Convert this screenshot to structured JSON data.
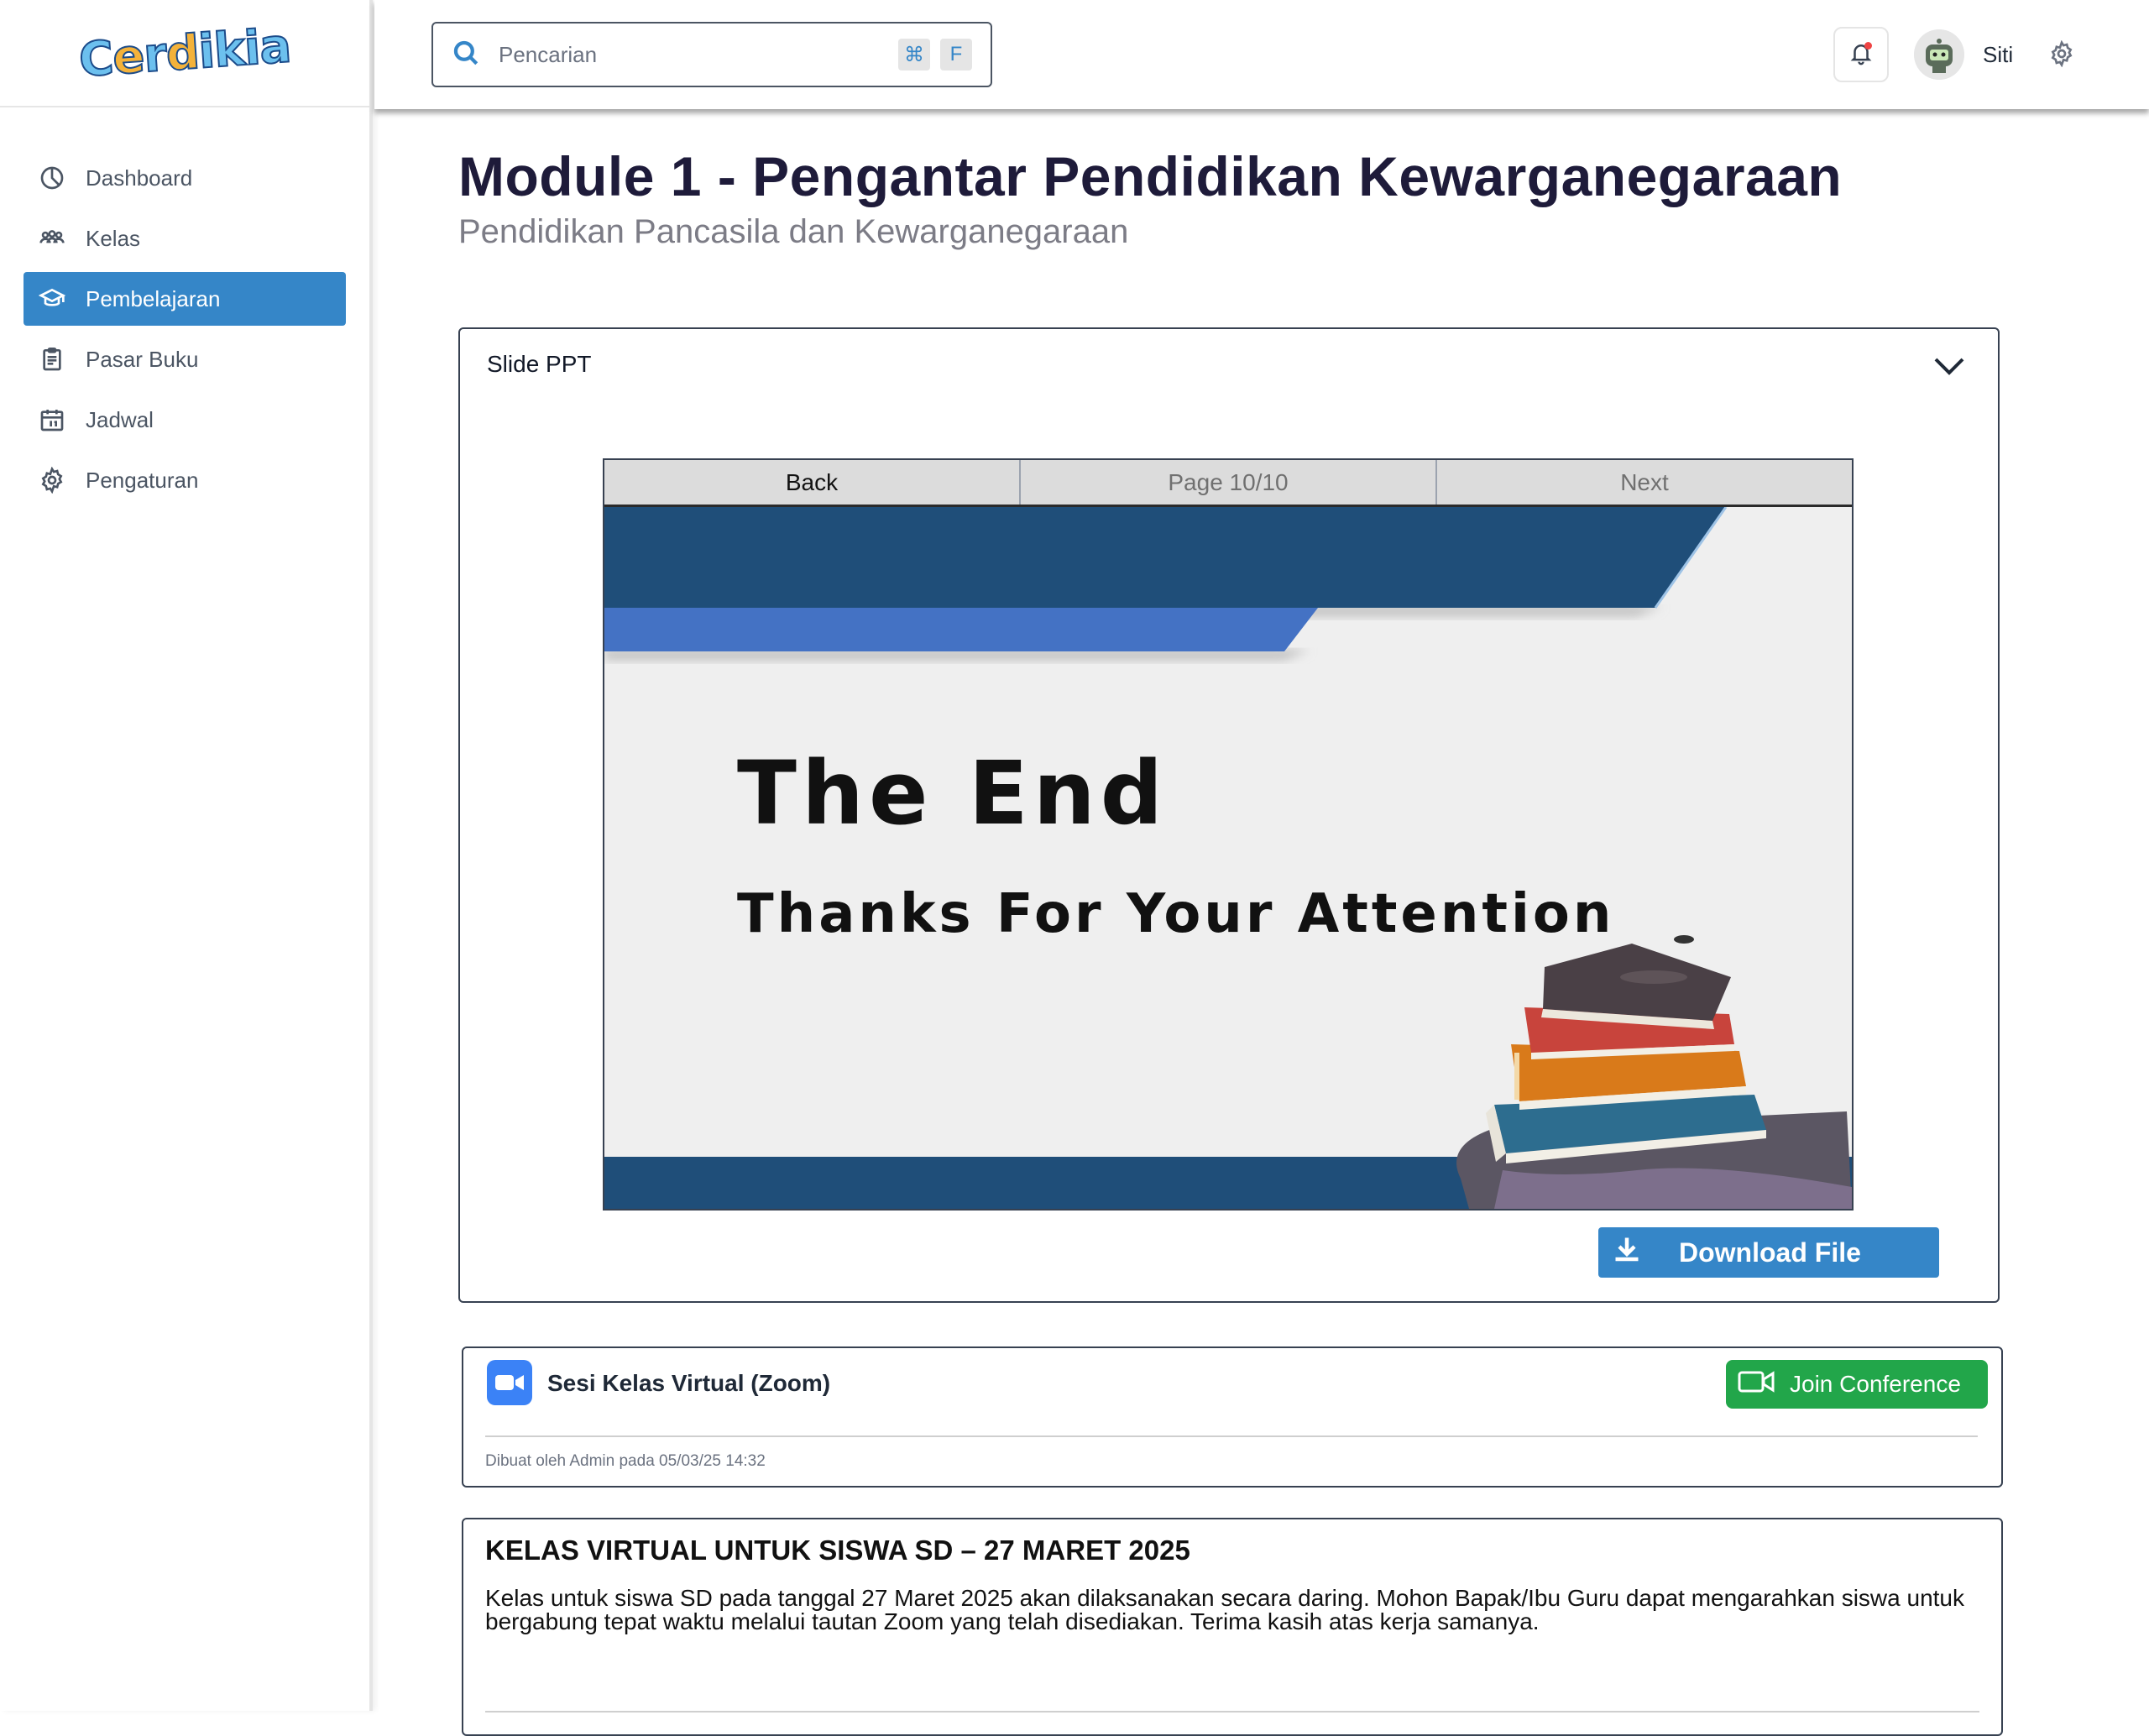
{
  "app": {
    "logo_text": "Cerdikia"
  },
  "sidebar": {
    "items": [
      {
        "label": "Dashboard",
        "icon": "pie-chart-icon"
      },
      {
        "label": "Kelas",
        "icon": "users-icon"
      },
      {
        "label": "Pembelajaran",
        "icon": "graduation-cap-icon",
        "active": true
      },
      {
        "label": "Pasar Buku",
        "icon": "clipboard-icon"
      },
      {
        "label": "Jadwal",
        "icon": "calendar-icon"
      },
      {
        "label": "Pengaturan",
        "icon": "gear-icon"
      }
    ]
  },
  "header": {
    "search": {
      "placeholder": "Pencarian",
      "shortcut_keys": [
        "⌘",
        "F"
      ]
    },
    "user": {
      "name": "Siti"
    }
  },
  "main": {
    "title": "Module 1 - Pengantar Pendidikan Kewarganegaraan",
    "subtitle": "Pendidikan Pancasila dan Kewarganegaraan",
    "slide_card": {
      "title": "Slide PPT",
      "viewer": {
        "back_label": "Back",
        "page_label": "Page 10/10",
        "next_label": "Next",
        "slide_title": "The End",
        "slide_subtitle": "Thanks For Your Attention"
      },
      "download_label": "Download File"
    },
    "zoom_card": {
      "title": "Sesi Kelas Virtual (Zoom)",
      "join_label": "Join Conference",
      "meta": "Dibuat oleh Admin pada 05/03/25 14:32"
    },
    "announcement": {
      "title": "KELAS VIRTUAL UNTUK SISWA SD – 27 MARET 2025",
      "body": "Kelas untuk siswa SD pada tanggal 27 Maret 2025 akan dilaksanakan secara daring. Mohon Bapak/Ibu Guru dapat mengarahkan siswa untuk bergabung tepat waktu melalui tautan Zoom yang telah disediakan. Terima kasih atas kerja samanya."
    }
  },
  "colors": {
    "accent": "#3586c8",
    "active_nav": "#3586c8",
    "join_button": "#22a64a",
    "slide_navy": "#1f4e79",
    "slide_blue": "#4472c4"
  }
}
